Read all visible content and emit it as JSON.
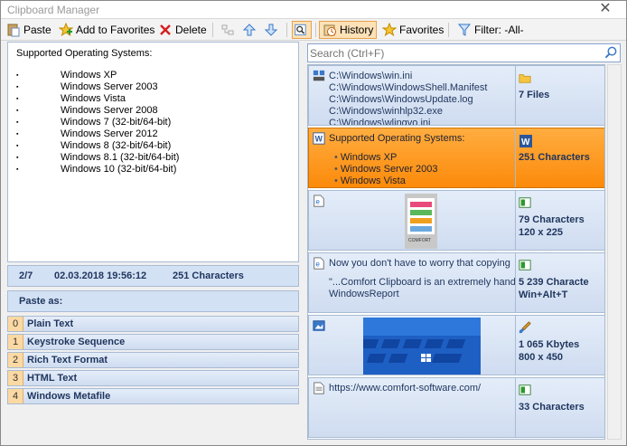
{
  "window": {
    "title": "Clipboard Manager",
    "close": "✕"
  },
  "toolbar": {
    "paste": "Paste",
    "add_favorites": "Add to Favorites",
    "delete": "Delete",
    "history": "History",
    "favorites": "Favorites",
    "filter": "Filter: -All-"
  },
  "document": {
    "heading": "Supported Operating Systems:",
    "items": [
      "Windows XP",
      "Windows Server 2003",
      "Windows Vista",
      "Windows Server 2008",
      "Windows 7 (32-bit/64-bit)",
      "Windows Server 2012",
      "Windows 8 (32-bit/64-bit)",
      "Windows 8.1 (32-bit/64-bit)",
      "Windows 10 (32-bit/64-bit)"
    ]
  },
  "status": {
    "position": "2/7",
    "date": "02.03.2018 19:56:12",
    "size": "251 Characters"
  },
  "paste_as": {
    "title": "Paste as:",
    "options": [
      {
        "key": "0",
        "label": "Plain Text"
      },
      {
        "key": "1",
        "label": "Keystroke Sequence"
      },
      {
        "key": "2",
        "label": "Rich Text Format"
      },
      {
        "key": "3",
        "label": "HTML Text"
      },
      {
        "key": "4",
        "label": "Windows Metafile"
      }
    ]
  },
  "search": {
    "placeholder": "Search (Ctrl+F)"
  },
  "history": {
    "files": {
      "lines": [
        "C:\\Windows\\win.ini",
        "C:\\Windows\\WindowsShell.Manifest",
        "C:\\Windows\\WindowsUpdate.log",
        "C:\\Windows\\winhlp32.exe",
        "C:\\Windows\\wlingvo.ini"
      ],
      "meta": "7 Files"
    },
    "rtf": {
      "heading": "Supported Operating Systems:",
      "bullets": [
        "Windows XP",
        "Windows Server 2003",
        "Windows Vista"
      ],
      "meta": "251 Characters"
    },
    "image1": {
      "meta1": "79 Characters",
      "meta2": "120 x 225",
      "thumb_text": "COMFORT"
    },
    "text": {
      "line1": "Now you don't have to worry that copying",
      "line2": "\"...Comfort Clipboard is an extremely hand",
      "line3": "WindowsReport",
      "meta1": "5 239 Characte",
      "meta2": "Win+Alt+T"
    },
    "image2": {
      "meta1": "1 065 Kbytes",
      "meta2": "800 x 450"
    },
    "url": {
      "text": "https://www.comfort-software.com/",
      "meta": "33 Characters"
    }
  },
  "colors": {
    "accent": "#fc8a0a",
    "panel": "#d3e1f4",
    "text": "#1f355e"
  }
}
